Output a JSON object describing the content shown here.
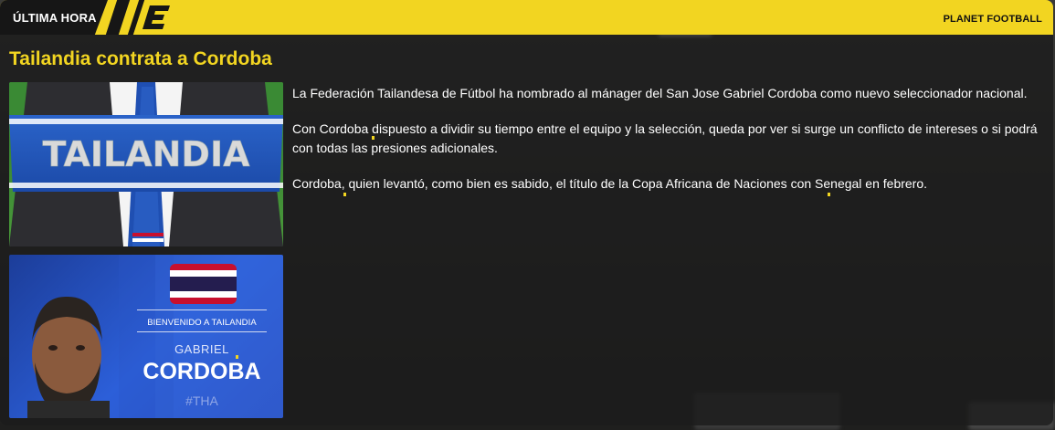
{
  "header": {
    "tag_label": "ÚLTIMA HORA",
    "source_label": "PLANET FOOTBALL"
  },
  "article": {
    "title": "Tailandia contrata a Cordoba",
    "paragraphs": [
      "La Federación Tailandesa de Fútbol ha nombrado al mánager del San Jose Gabriel Cordoba como nuevo seleccionador nacional.",
      "Con Cordoba dispuesto a dividir su tiempo entre el equipo y la selección, queda por ver si surge un conflicto de intereses o si podrá con todas las presiones adicionales.",
      "Cordoba, quien levantó, como bien es sabido, el título de la Copa Africana de Naciones con Senegal en febrero."
    ]
  },
  "image_scarf": {
    "scarf_text": "TAILANDIA"
  },
  "welcome_card": {
    "caption": "BIENVENIDO A TAILANDIA",
    "first_name": "GABRIEL",
    "last_name": "CORDOBA",
    "hashtag": "#THA"
  },
  "colors": {
    "accent": "#f2d521",
    "panel": "#1c1c1c",
    "card_blue": "#2c5fd9"
  }
}
